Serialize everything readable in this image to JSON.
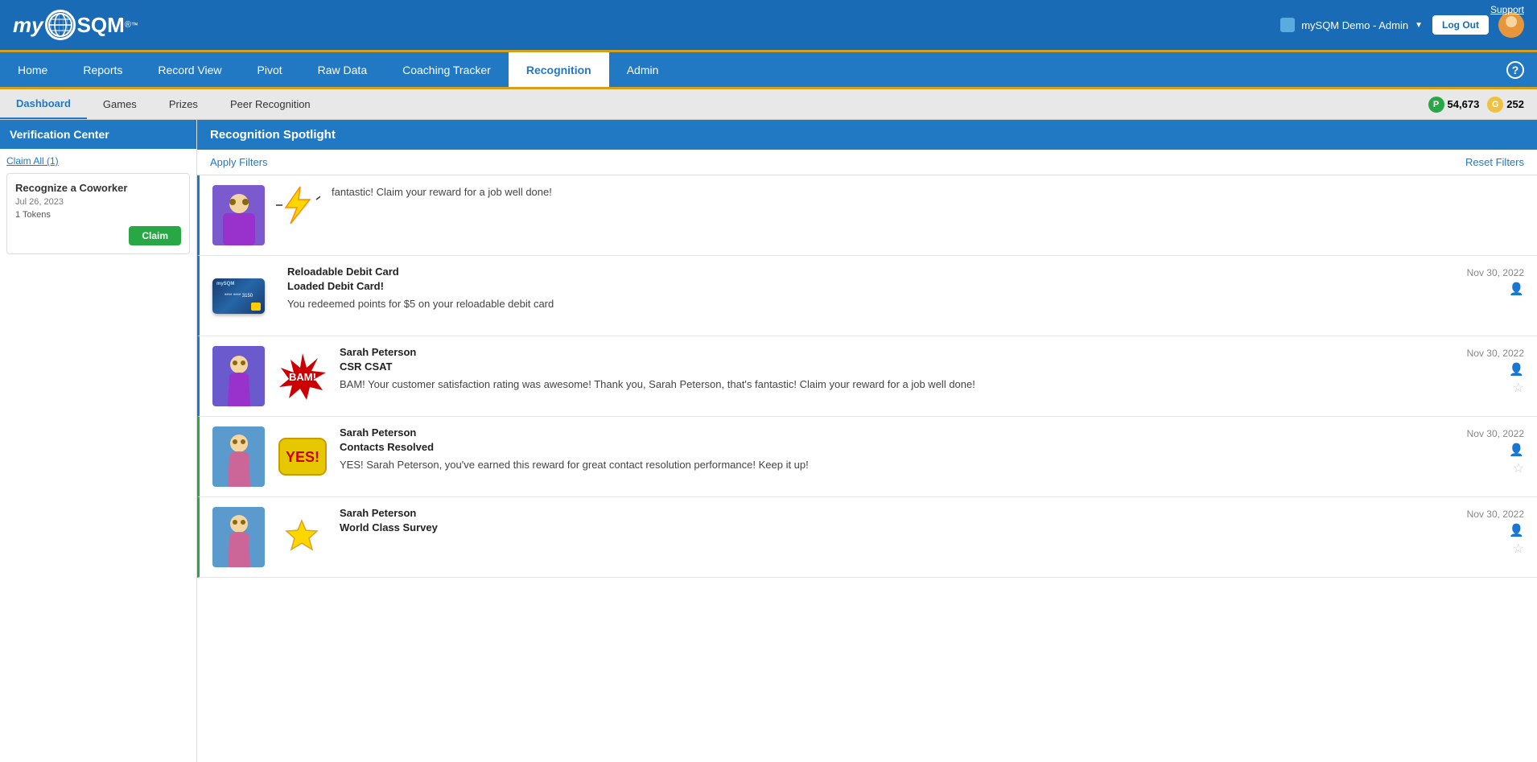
{
  "topBar": {
    "logo": "mySQM",
    "supportLabel": "Support",
    "userInfo": "mySQM Demo - Admin",
    "logoutLabel": "Log Out"
  },
  "nav": {
    "items": [
      {
        "label": "Home",
        "id": "home"
      },
      {
        "label": "Reports",
        "id": "reports"
      },
      {
        "label": "Record View",
        "id": "record-view"
      },
      {
        "label": "Pivot",
        "id": "pivot"
      },
      {
        "label": "Raw Data",
        "id": "raw-data"
      },
      {
        "label": "Coaching Tracker",
        "id": "coaching-tracker"
      },
      {
        "label": "Recognition",
        "id": "recognition",
        "active": true
      },
      {
        "label": "Admin",
        "id": "admin"
      }
    ]
  },
  "subNav": {
    "items": [
      {
        "label": "Dashboard",
        "id": "dashboard",
        "active": true
      },
      {
        "label": "Games",
        "id": "games"
      },
      {
        "label": "Prizes",
        "id": "prizes"
      },
      {
        "label": "Peer Recognition",
        "id": "peer-recognition"
      }
    ],
    "points": {
      "p_label": "P",
      "p_value": "54,673",
      "g_label": "G",
      "g_value": "252"
    }
  },
  "sidebar": {
    "title": "Verification Center",
    "claimAll": "Claim All (1)",
    "card": {
      "title": "Recognize a Coworker",
      "date": "Jul 26, 2023",
      "tokens": "1 Tokens",
      "claimLabel": "Claim"
    }
  },
  "spotlight": {
    "title": "Recognition Spotlight",
    "applyFilters": "Apply Filters",
    "resetFilters": "Reset Filters",
    "entries": [
      {
        "id": "entry-0",
        "avatarType": "person",
        "badgeType": "lightning",
        "title": "",
        "name": "",
        "description": "fantastic! Claim your reward for a job well done!",
        "date": "",
        "borderColor": "blue"
      },
      {
        "id": "entry-1",
        "avatarType": "debit",
        "badgeType": "none",
        "title": "Reloadable Debit Card",
        "name": "Loaded Debit Card!",
        "description": "You redeemed points for $5 on your reloadable debit card",
        "date": "Nov 30, 2022",
        "borderColor": "blue"
      },
      {
        "id": "entry-2",
        "avatarType": "person",
        "badgeType": "bam",
        "title": "Sarah Peterson",
        "name": "CSR CSAT",
        "description": "BAM! Your customer satisfaction rating was awesome! Thank you, Sarah Peterson, that's fantastic! Claim your reward for a job well done!",
        "date": "Nov 30, 2022",
        "borderColor": "blue"
      },
      {
        "id": "entry-3",
        "avatarType": "person2",
        "badgeType": "yes",
        "title": "Sarah Peterson",
        "name": "Contacts Resolved",
        "description": "YES! Sarah Peterson, you've earned this reward for great contact resolution performance! Keep it up!",
        "date": "Nov 30, 2022",
        "borderColor": "green"
      },
      {
        "id": "entry-4",
        "avatarType": "person2",
        "badgeType": "trophy",
        "title": "Sarah Peterson",
        "name": "World Class Survey",
        "description": "",
        "date": "Nov 30, 2022",
        "borderColor": "green"
      }
    ]
  }
}
